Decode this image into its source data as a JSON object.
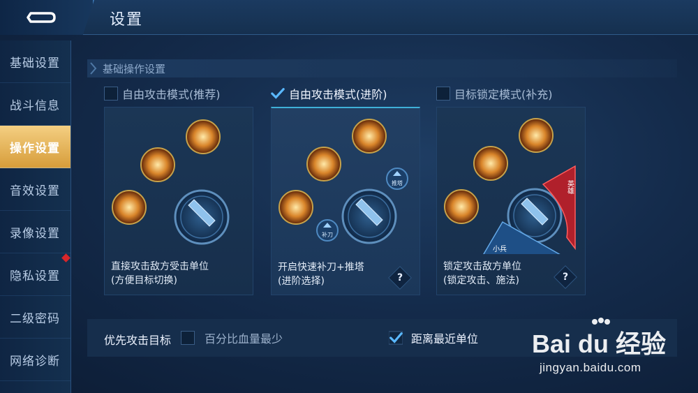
{
  "header": {
    "title": "设置"
  },
  "sidebar": {
    "items": [
      {
        "label": "基础设置"
      },
      {
        "label": "战斗信息"
      },
      {
        "label": "操作设置"
      },
      {
        "label": "音效设置"
      },
      {
        "label": "录像设置"
      },
      {
        "label": "隐私设置"
      },
      {
        "label": "二级密码"
      },
      {
        "label": "网络诊断"
      }
    ],
    "active_index": 2
  },
  "section": {
    "title": "基础操作设置"
  },
  "modes": [
    {
      "label": "自由攻击模式(推荐)",
      "checked": false,
      "desc_line1": "直接攻击敌方受击单位",
      "desc_line2": "(方便目标切换)"
    },
    {
      "label": "自由攻击模式(进阶)",
      "checked": true,
      "desc_line1": "开启快速补刀+推塔",
      "desc_line2": "(进阶选择)",
      "icon_top": "推塔",
      "icon_bottom": "补刀"
    },
    {
      "label": "目标锁定模式(补充)",
      "checked": false,
      "desc_line1": "锁定攻击敌方单位",
      "desc_line2": "(锁定攻击、施法)",
      "tag_hero": "英雄",
      "tag_minion": "小兵"
    }
  ],
  "help_symbol": "?",
  "priority": {
    "label": "优先攻击目标",
    "option1": {
      "label": "百分比血量最少",
      "checked": false
    },
    "option2": {
      "label": "距离最近单位",
      "checked": true
    }
  },
  "watermark": {
    "brand": "Bai du 经验",
    "url": "jingyan.baidu.com"
  },
  "colors": {
    "active_tab": "#e8b45a",
    "accent": "#3fb0d8",
    "check": "#5ab8ff"
  }
}
